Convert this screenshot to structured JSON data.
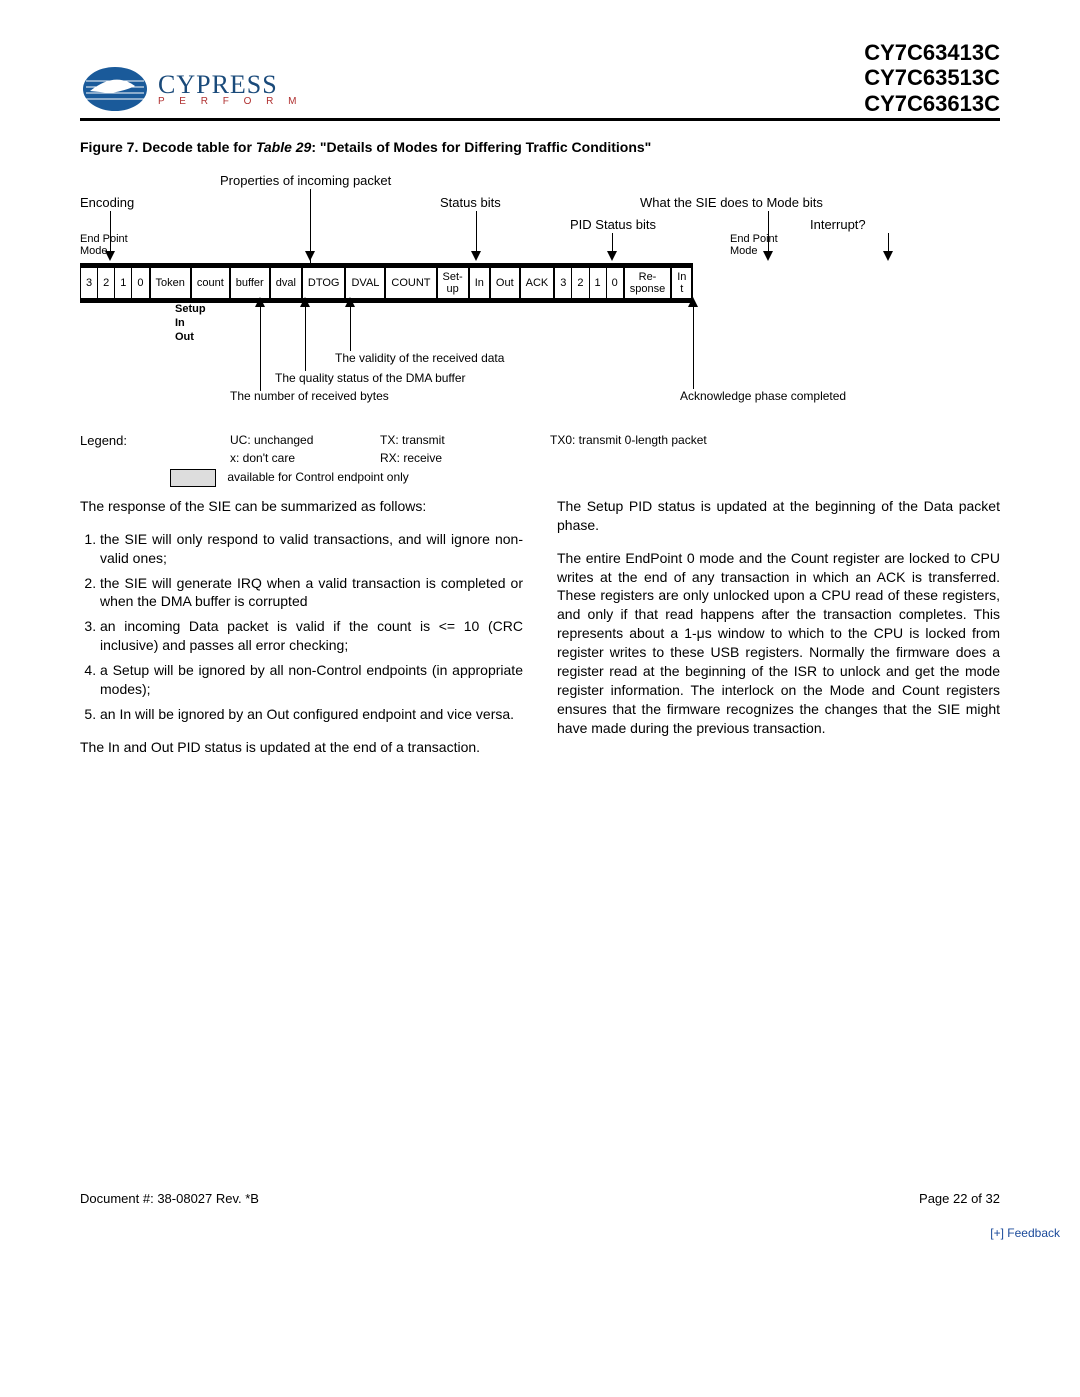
{
  "header": {
    "logo_main": "CYPRESS",
    "logo_sub": "P E R F O R M",
    "parts": [
      "CY7C63413C",
      "CY7C63513C",
      "CY7C63613C"
    ]
  },
  "figure": {
    "caption_prefix": "Figure 7. Decode table for",
    "caption_ref": "Table 29",
    "caption_suffix": ": \"Details of Modes for Differing Traffic Conditions\"",
    "top_labels": {
      "properties": "Properties of incoming packet",
      "encoding": "Encoding",
      "status_bits": "Status bits",
      "sie_action": "What the SIE does to Mode bits",
      "pid_status": "PID Status bits",
      "interrupt": "Interrupt?",
      "endpoint_mode_left": "End Point\nMode",
      "endpoint_mode_right": "End Point\nMode"
    },
    "cells": [
      "3",
      "2",
      "1",
      "0",
      "Token",
      "count",
      "buffer",
      "dval",
      "DTOG",
      "DVAL",
      "COUNT",
      "Set-\nup",
      "In",
      "Out",
      "ACK",
      "3",
      "2",
      "1",
      "0",
      "Re-\nsponse",
      "In\nt"
    ],
    "token_list": [
      "Setup",
      "In",
      "Out"
    ],
    "annotations": {
      "validity": "The validity of the received data",
      "quality": "The quality status of the DMA buffer",
      "count_note": "The number of received bytes",
      "ack_note": "Acknowledge phase completed"
    }
  },
  "legend": {
    "title": "Legend:",
    "items": {
      "uc": "UC: unchanged",
      "x": "x: don't care",
      "tx": "TX: transmit",
      "rx": "RX: receive",
      "tx0": "TX0: transmit 0-length packet",
      "box": "available for Control endpoint only"
    }
  },
  "body": {
    "intro": "The response of the SIE can be summarized as follows:",
    "list": [
      "the SIE will only respond to valid transactions, and will ignore non-valid ones;",
      "the SIE will generate IRQ when a valid transaction is completed or when the DMA buffer is corrupted",
      "an incoming Data packet is valid if the count is <= 10 (CRC inclusive) and passes all error checking;",
      "a Setup will be ignored by all non-Control endpoints (in appropriate modes);",
      "an In will be ignored by an Out configured endpoint and vice versa."
    ],
    "left_para": "The In and Out PID status is updated at the end of a transaction.",
    "right_para1": "The Setup PID status is updated at the beginning of the Data packet phase.",
    "right_para2": "The entire EndPoint 0 mode and the Count register are locked to CPU writes at the end of any transaction in which an ACK is transferred. These registers are only unlocked upon a CPU read of these registers, and only if that read happens after the transaction completes. This represents about a 1-μs window to which to the CPU is locked from register writes to these USB registers. Normally the firmware does a register read at the beginning of the ISR to unlock and get the mode register information. The interlock on the Mode and Count registers ensures that the firmware recognizes the changes that the SIE might have made during the previous transaction."
  },
  "footer": {
    "doc": "Document #: 38-08027  Rev. *B",
    "page": "Page 22 of 32",
    "feedback": "[+] Feedback"
  }
}
